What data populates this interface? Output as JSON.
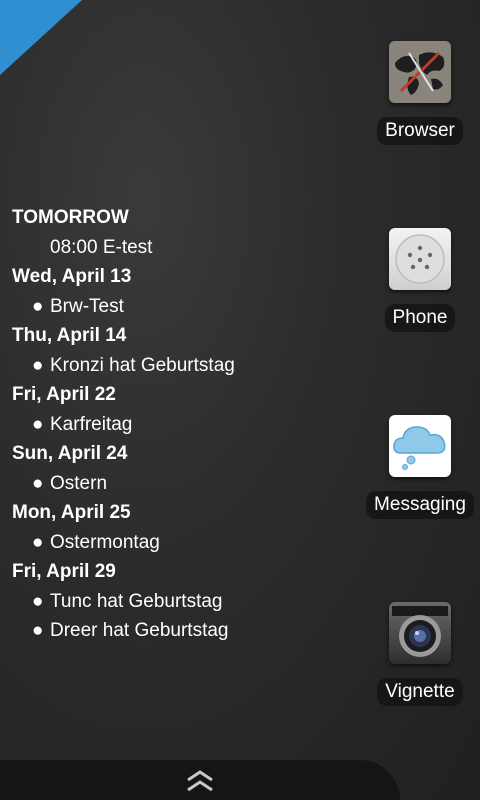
{
  "agenda": [
    {
      "day": "TOMORROW",
      "events": [
        {
          "bullet": "",
          "text": "08:00 E-test"
        }
      ]
    },
    {
      "day": "Wed, April 13",
      "events": [
        {
          "bullet": "●",
          "text": "Brw-Test"
        }
      ]
    },
    {
      "day": "Thu, April 14",
      "events": [
        {
          "bullet": "●",
          "text": "Kronzi hat Geburtstag"
        }
      ]
    },
    {
      "day": "Fri, April 22",
      "events": [
        {
          "bullet": "●",
          "text": "Karfreitag"
        }
      ]
    },
    {
      "day": "Sun, April 24",
      "events": [
        {
          "bullet": "●",
          "text": "Ostern"
        }
      ]
    },
    {
      "day": "Mon, April 25",
      "events": [
        {
          "bullet": "●",
          "text": "Ostermontag"
        }
      ]
    },
    {
      "day": "Fri, April 29",
      "events": [
        {
          "bullet": "●",
          "text": "Tunc hat Geburtstag"
        },
        {
          "bullet": "●",
          "text": "Dreer hat Geburtstag"
        }
      ]
    }
  ],
  "shortcuts": {
    "browser": {
      "label": "Browser",
      "icon": "browser-world-map-icon"
    },
    "phone": {
      "label": "Phone",
      "icon": "phone-keypad-icon"
    },
    "messaging": {
      "label": "Messaging",
      "icon": "messaging-cloud-icon"
    },
    "vignette": {
      "label": "Vignette",
      "icon": "camera-icon"
    }
  },
  "dock": {
    "icon": "double-chevron-up-icon"
  },
  "colors": {
    "accent": "#2f8fd0",
    "background": "#2b2b2b"
  }
}
